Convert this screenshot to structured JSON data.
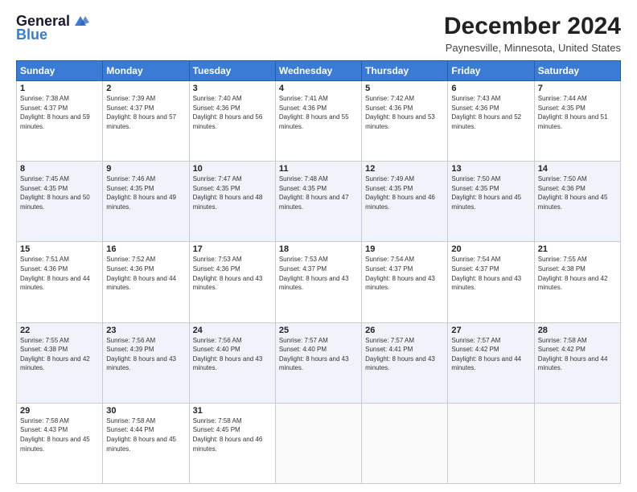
{
  "header": {
    "logo_line1": "General",
    "logo_line2": "Blue",
    "month_year": "December 2024",
    "location": "Paynesville, Minnesota, United States"
  },
  "days_of_week": [
    "Sunday",
    "Monday",
    "Tuesday",
    "Wednesday",
    "Thursday",
    "Friday",
    "Saturday"
  ],
  "weeks": [
    [
      {
        "day": 1,
        "sunrise": "7:38 AM",
        "sunset": "4:37 PM",
        "daylight": "8 hours and 59 minutes."
      },
      {
        "day": 2,
        "sunrise": "7:39 AM",
        "sunset": "4:37 PM",
        "daylight": "8 hours and 57 minutes."
      },
      {
        "day": 3,
        "sunrise": "7:40 AM",
        "sunset": "4:36 PM",
        "daylight": "8 hours and 56 minutes."
      },
      {
        "day": 4,
        "sunrise": "7:41 AM",
        "sunset": "4:36 PM",
        "daylight": "8 hours and 55 minutes."
      },
      {
        "day": 5,
        "sunrise": "7:42 AM",
        "sunset": "4:36 PM",
        "daylight": "8 hours and 53 minutes."
      },
      {
        "day": 6,
        "sunrise": "7:43 AM",
        "sunset": "4:36 PM",
        "daylight": "8 hours and 52 minutes."
      },
      {
        "day": 7,
        "sunrise": "7:44 AM",
        "sunset": "4:35 PM",
        "daylight": "8 hours and 51 minutes."
      }
    ],
    [
      {
        "day": 8,
        "sunrise": "7:45 AM",
        "sunset": "4:35 PM",
        "daylight": "8 hours and 50 minutes."
      },
      {
        "day": 9,
        "sunrise": "7:46 AM",
        "sunset": "4:35 PM",
        "daylight": "8 hours and 49 minutes."
      },
      {
        "day": 10,
        "sunrise": "7:47 AM",
        "sunset": "4:35 PM",
        "daylight": "8 hours and 48 minutes."
      },
      {
        "day": 11,
        "sunrise": "7:48 AM",
        "sunset": "4:35 PM",
        "daylight": "8 hours and 47 minutes."
      },
      {
        "day": 12,
        "sunrise": "7:49 AM",
        "sunset": "4:35 PM",
        "daylight": "8 hours and 46 minutes."
      },
      {
        "day": 13,
        "sunrise": "7:50 AM",
        "sunset": "4:35 PM",
        "daylight": "8 hours and 45 minutes."
      },
      {
        "day": 14,
        "sunrise": "7:50 AM",
        "sunset": "4:36 PM",
        "daylight": "8 hours and 45 minutes."
      }
    ],
    [
      {
        "day": 15,
        "sunrise": "7:51 AM",
        "sunset": "4:36 PM",
        "daylight": "8 hours and 44 minutes."
      },
      {
        "day": 16,
        "sunrise": "7:52 AM",
        "sunset": "4:36 PM",
        "daylight": "8 hours and 44 minutes."
      },
      {
        "day": 17,
        "sunrise": "7:53 AM",
        "sunset": "4:36 PM",
        "daylight": "8 hours and 43 minutes."
      },
      {
        "day": 18,
        "sunrise": "7:53 AM",
        "sunset": "4:37 PM",
        "daylight": "8 hours and 43 minutes."
      },
      {
        "day": 19,
        "sunrise": "7:54 AM",
        "sunset": "4:37 PM",
        "daylight": "8 hours and 43 minutes."
      },
      {
        "day": 20,
        "sunrise": "7:54 AM",
        "sunset": "4:37 PM",
        "daylight": "8 hours and 43 minutes."
      },
      {
        "day": 21,
        "sunrise": "7:55 AM",
        "sunset": "4:38 PM",
        "daylight": "8 hours and 42 minutes."
      }
    ],
    [
      {
        "day": 22,
        "sunrise": "7:55 AM",
        "sunset": "4:38 PM",
        "daylight": "8 hours and 42 minutes."
      },
      {
        "day": 23,
        "sunrise": "7:56 AM",
        "sunset": "4:39 PM",
        "daylight": "8 hours and 43 minutes."
      },
      {
        "day": 24,
        "sunrise": "7:56 AM",
        "sunset": "4:40 PM",
        "daylight": "8 hours and 43 minutes."
      },
      {
        "day": 25,
        "sunrise": "7:57 AM",
        "sunset": "4:40 PM",
        "daylight": "8 hours and 43 minutes."
      },
      {
        "day": 26,
        "sunrise": "7:57 AM",
        "sunset": "4:41 PM",
        "daylight": "8 hours and 43 minutes."
      },
      {
        "day": 27,
        "sunrise": "7:57 AM",
        "sunset": "4:42 PM",
        "daylight": "8 hours and 44 minutes."
      },
      {
        "day": 28,
        "sunrise": "7:58 AM",
        "sunset": "4:42 PM",
        "daylight": "8 hours and 44 minutes."
      }
    ],
    [
      {
        "day": 29,
        "sunrise": "7:58 AM",
        "sunset": "4:43 PM",
        "daylight": "8 hours and 45 minutes."
      },
      {
        "day": 30,
        "sunrise": "7:58 AM",
        "sunset": "4:44 PM",
        "daylight": "8 hours and 45 minutes."
      },
      {
        "day": 31,
        "sunrise": "7:58 AM",
        "sunset": "4:45 PM",
        "daylight": "8 hours and 46 minutes."
      },
      null,
      null,
      null,
      null
    ]
  ]
}
